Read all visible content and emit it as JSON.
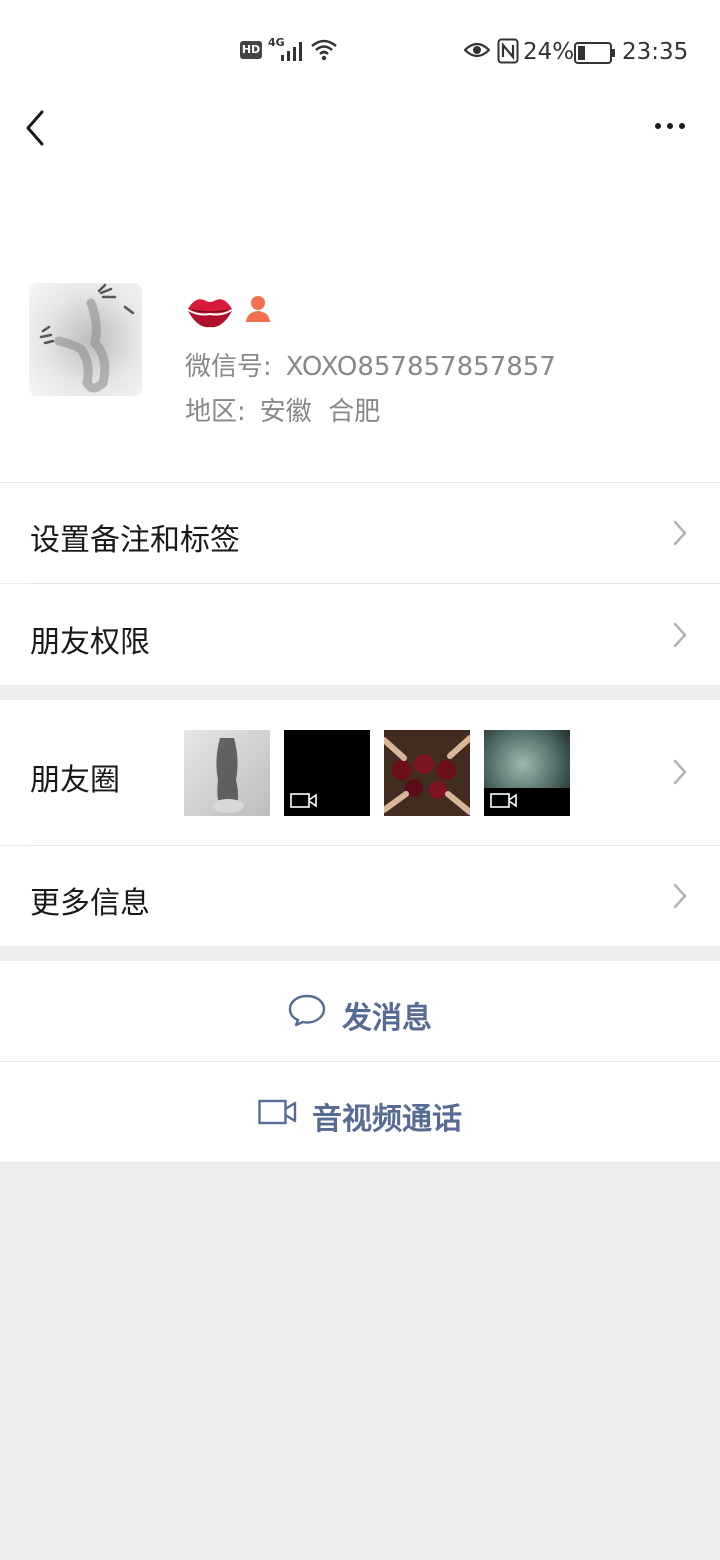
{
  "status_bar": {
    "hd_label": "HD",
    "network_label": "4G",
    "battery_percent": "24%",
    "battery_level": 0.24,
    "time": "23:35"
  },
  "nav": {
    "back_icon": "chevron-left-icon",
    "more_icon": "ellipsis-icon"
  },
  "profile": {
    "nickname_icons": [
      "lips-emoji-icon",
      "female-gender-icon"
    ],
    "wechat_id_label": "微信号:",
    "wechat_id": "XOXO857857857857",
    "region_label": "地区:",
    "region_value": "安徽  合肥"
  },
  "menu": {
    "remark_tags": "设置备注和标签",
    "friend_permissions": "朋友权限",
    "moments": "朋友圈",
    "more_info": "更多信息"
  },
  "moments_thumbnails": [
    {
      "kind": "photo",
      "icon": "photo-thumbnail"
    },
    {
      "kind": "video",
      "icon": "video-camera-icon"
    },
    {
      "kind": "photo",
      "icon": "photo-thumbnail"
    },
    {
      "kind": "video",
      "icon": "video-camera-icon"
    }
  ],
  "actions": {
    "send_message": "发消息",
    "video_call": "音视频通话"
  },
  "colors": {
    "accent_link": "#576b95",
    "background": "#ededed",
    "card": "#ffffff",
    "secondary_text": "#888888"
  }
}
